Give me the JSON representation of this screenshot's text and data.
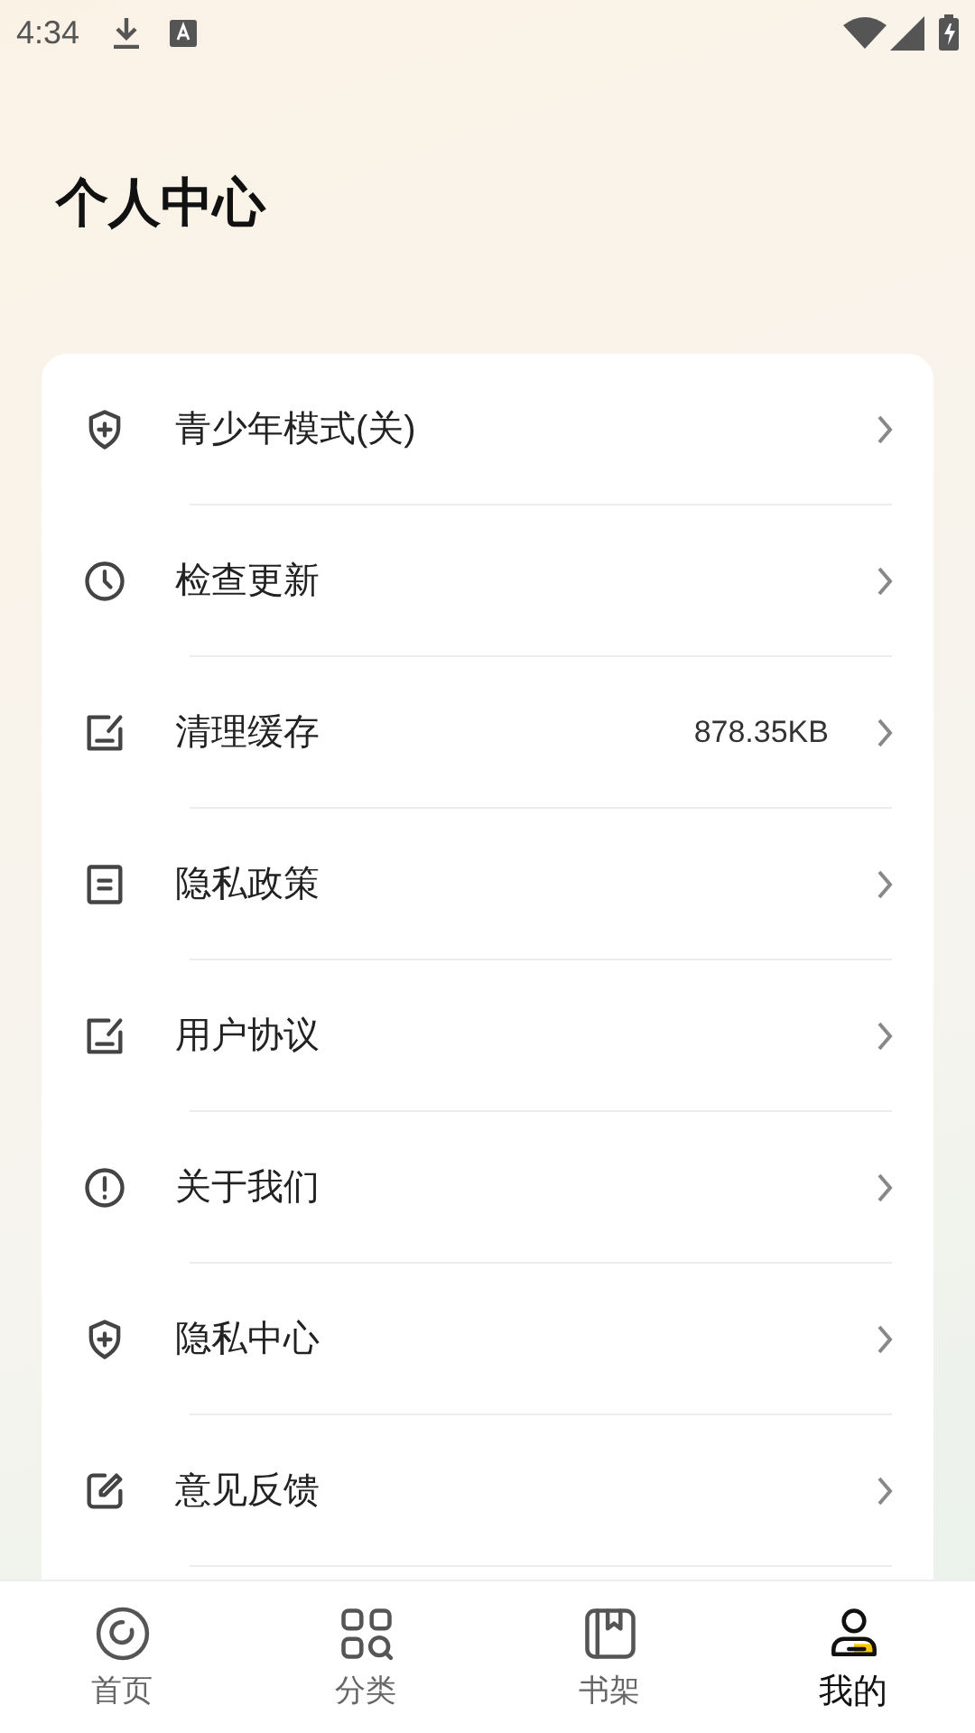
{
  "status_bar": {
    "time": "4:34"
  },
  "header": {
    "title": "个人中心"
  },
  "menu": [
    {
      "kind": "shield",
      "label": "青少年模式(关)"
    },
    {
      "kind": "clock",
      "label": "检查更新"
    },
    {
      "kind": "note",
      "label": "清理缓存",
      "value": "878.35KB"
    },
    {
      "kind": "document",
      "label": "隐私政策"
    },
    {
      "kind": "note",
      "label": "用户协议"
    },
    {
      "kind": "info",
      "label": "关于我们"
    },
    {
      "kind": "shield",
      "label": "隐私中心"
    },
    {
      "kind": "edit",
      "label": "意见反馈"
    }
  ],
  "tabs": [
    {
      "kind": "home",
      "label": "首页",
      "selected": false
    },
    {
      "kind": "category",
      "label": "分类",
      "selected": false
    },
    {
      "kind": "shelf",
      "label": "书架",
      "selected": false
    },
    {
      "kind": "profile",
      "label": "我的",
      "selected": true
    }
  ]
}
